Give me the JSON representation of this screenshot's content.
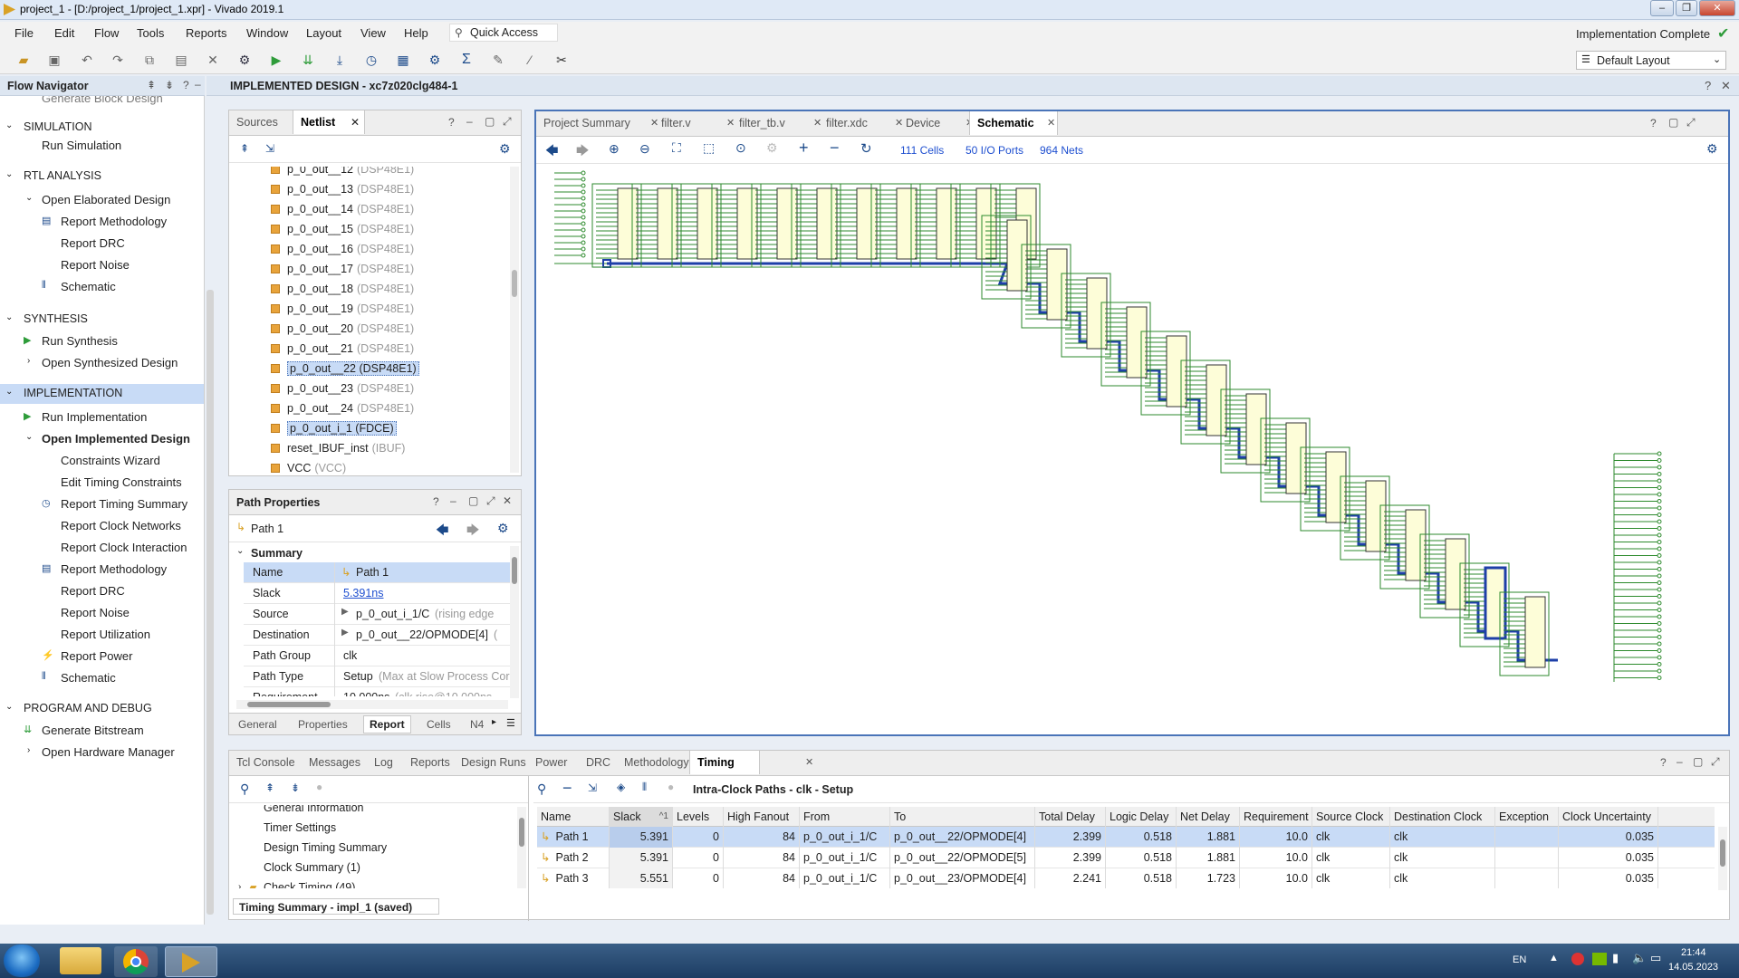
{
  "window": {
    "title": "project_1 - [D:/project_1/project_1.xpr] - Vivado 2019.1",
    "status": "Implementation Complete",
    "layout": "Default Layout"
  },
  "menu": [
    "File",
    "Edit",
    "Flow",
    "Tools",
    "Reports",
    "Window",
    "Layout",
    "View",
    "Help"
  ],
  "quick_access": "Quick Access",
  "nav": {
    "title": "Flow Navigator",
    "items": [
      {
        "label": "Generate Block Design",
        "level": 2,
        "type": "item"
      },
      {
        "label": "SIMULATION",
        "level": 0,
        "type": "section"
      },
      {
        "label": "Run Simulation",
        "level": 2,
        "type": "item"
      },
      {
        "label": "RTL ANALYSIS",
        "level": 0,
        "type": "section"
      },
      {
        "label": "Open Elaborated Design",
        "level": 1,
        "type": "group"
      },
      {
        "label": "Report Methodology",
        "level": 3,
        "type": "item",
        "icon": "clipboard"
      },
      {
        "label": "Report DRC",
        "level": 3,
        "type": "item"
      },
      {
        "label": "Report Noise",
        "level": 3,
        "type": "item"
      },
      {
        "label": "Schematic",
        "level": 3,
        "type": "item",
        "icon": "schematic"
      },
      {
        "label": "SYNTHESIS",
        "level": 0,
        "type": "section"
      },
      {
        "label": "Run Synthesis",
        "level": 1,
        "type": "run"
      },
      {
        "label": "Open Synthesized Design",
        "level": 1,
        "type": "group-closed"
      },
      {
        "label": "IMPLEMENTATION",
        "level": 0,
        "type": "section-active"
      },
      {
        "label": "Run Implementation",
        "level": 1,
        "type": "run"
      },
      {
        "label": "Open Implemented Design",
        "level": 1,
        "type": "group-bold"
      },
      {
        "label": "Constraints Wizard",
        "level": 3,
        "type": "item"
      },
      {
        "label": "Edit Timing Constraints",
        "level": 3,
        "type": "item"
      },
      {
        "label": "Report Timing Summary",
        "level": 3,
        "type": "item",
        "icon": "clock"
      },
      {
        "label": "Report Clock Networks",
        "level": 3,
        "type": "item"
      },
      {
        "label": "Report Clock Interaction",
        "level": 3,
        "type": "item"
      },
      {
        "label": "Report Methodology",
        "level": 3,
        "type": "item",
        "icon": "clipboard"
      },
      {
        "label": "Report DRC",
        "level": 3,
        "type": "item"
      },
      {
        "label": "Report Noise",
        "level": 3,
        "type": "item"
      },
      {
        "label": "Report Utilization",
        "level": 3,
        "type": "item"
      },
      {
        "label": "Report Power",
        "level": 3,
        "type": "item",
        "icon": "power"
      },
      {
        "label": "Schematic",
        "level": 3,
        "type": "item",
        "icon": "schematic"
      },
      {
        "label": "PROGRAM AND DEBUG",
        "level": 0,
        "type": "section"
      },
      {
        "label": "Generate Bitstream",
        "level": 1,
        "type": "bitstream"
      },
      {
        "label": "Open Hardware Manager",
        "level": 1,
        "type": "group-closed"
      }
    ]
  },
  "design_header": "IMPLEMENTED DESIGN - xc7z020clg484-1",
  "netlist": {
    "tabs": [
      "Sources",
      "Netlist"
    ],
    "rows": [
      {
        "name": "p_0_out__12",
        "type": "(DSP48E1)"
      },
      {
        "name": "p_0_out__13",
        "type": "(DSP48E1)"
      },
      {
        "name": "p_0_out__14",
        "type": "(DSP48E1)"
      },
      {
        "name": "p_0_out__15",
        "type": "(DSP48E1)"
      },
      {
        "name": "p_0_out__16",
        "type": "(DSP48E1)"
      },
      {
        "name": "p_0_out__17",
        "type": "(DSP48E1)"
      },
      {
        "name": "p_0_out__18",
        "type": "(DSP48E1)"
      },
      {
        "name": "p_0_out__19",
        "type": "(DSP48E1)"
      },
      {
        "name": "p_0_out__20",
        "type": "(DSP48E1)"
      },
      {
        "name": "p_0_out__21",
        "type": "(DSP48E1)"
      },
      {
        "name": "p_0_out__22 (DSP48E1)",
        "type": "",
        "selected": true
      },
      {
        "name": "p_0_out__23",
        "type": "(DSP48E1)"
      },
      {
        "name": "p_0_out__24",
        "type": "(DSP48E1)"
      },
      {
        "name": "p_0_out_i_1 (FDCE)",
        "type": "",
        "selected": true
      },
      {
        "name": "reset_IBUF_inst",
        "type": "(IBUF)"
      },
      {
        "name": "VCC",
        "type": "(VCC)"
      }
    ]
  },
  "path_props": {
    "title": "Path Properties",
    "path": "Path 1",
    "section": "Summary",
    "rows": [
      {
        "k": "Name",
        "v": "Path 1",
        "extra": ""
      },
      {
        "k": "Slack",
        "v": "5.391ns",
        "extra": ""
      },
      {
        "k": "Source",
        "v": "p_0_out_i_1/C",
        "extra": "(rising edge"
      },
      {
        "k": "Destination",
        "v": "p_0_out__22/OPMODE[4]",
        "extra": "("
      },
      {
        "k": "Path Group",
        "v": "clk",
        "extra": ""
      },
      {
        "k": "Path Type",
        "v": "Setup",
        "extra": "(Max at Slow Process Cor"
      },
      {
        "k": "Requirement",
        "v": "10.000ns",
        "extra": "(clk rise@10.000ns"
      }
    ],
    "tabs": [
      "General",
      "Properties",
      "Report",
      "Cells",
      "N4"
    ]
  },
  "schematic": {
    "tabs": [
      "Project Summary",
      "filter.v",
      "filter_tb.v",
      "filter.xdc",
      "Device",
      "Schematic"
    ],
    "cells": "111 Cells",
    "ports": "50 I/O Ports",
    "nets": "964 Nets"
  },
  "bottom": {
    "tabs": [
      "Tcl Console",
      "Messages",
      "Log",
      "Reports",
      "Design Runs",
      "Power",
      "DRC",
      "Methodology",
      "Timing"
    ],
    "tree": [
      "General Information",
      "Timer Settings",
      "Design Timing Summary",
      "Clock Summary (1)",
      "Check Timing (49)"
    ],
    "summary_label": "Timing Summary - impl_1 (saved)",
    "paths_title": "Intra-Clock Paths - clk - Setup",
    "columns": [
      "Name",
      "Slack",
      "Levels",
      "High Fanout",
      "From",
      "To",
      "Total Delay",
      "Logic Delay",
      "Net Delay",
      "Requirement",
      "Source Clock",
      "Destination Clock",
      "Exception",
      "Clock Uncertainty"
    ],
    "slack_sort": "^1",
    "rows": [
      [
        "Path 1",
        "5.391",
        "0",
        "84",
        "p_0_out_i_1/C",
        "p_0_out__22/OPMODE[4]",
        "2.399",
        "0.518",
        "1.881",
        "10.0",
        "clk",
        "clk",
        "",
        "0.035"
      ],
      [
        "Path 2",
        "5.391",
        "0",
        "84",
        "p_0_out_i_1/C",
        "p_0_out__22/OPMODE[5]",
        "2.399",
        "0.518",
        "1.881",
        "10.0",
        "clk",
        "clk",
        "",
        "0.035"
      ],
      [
        "Path 3",
        "5.551",
        "0",
        "84",
        "p_0_out_i_1/C",
        "p_0_out__23/OPMODE[4]",
        "2.241",
        "0.518",
        "1.723",
        "10.0",
        "clk",
        "clk",
        "",
        "0.035"
      ]
    ]
  },
  "taskbar": {
    "lang": "EN",
    "time": "21:44",
    "date": "14.05.2023"
  }
}
